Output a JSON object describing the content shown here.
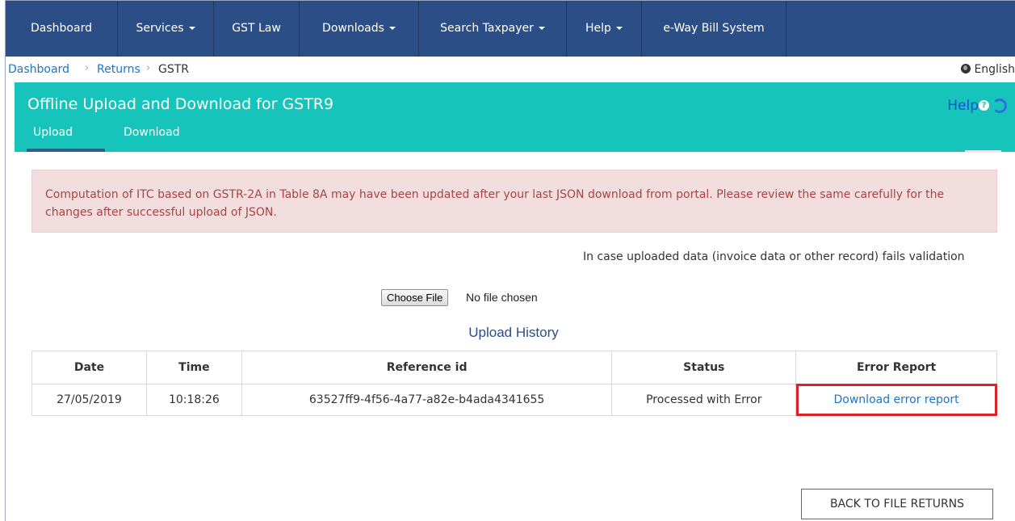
{
  "nav": {
    "items": [
      {
        "label": "Dashboard",
        "dropdown": false
      },
      {
        "label": "Services",
        "dropdown": true
      },
      {
        "label": "GST Law",
        "dropdown": false
      },
      {
        "label": "Downloads",
        "dropdown": true
      },
      {
        "label": "Search Taxpayer",
        "dropdown": true
      },
      {
        "label": "Help",
        "dropdown": true
      },
      {
        "label": "e-Way Bill System",
        "dropdown": false
      }
    ]
  },
  "breadcrumb": {
    "items": [
      "Dashboard",
      "Returns",
      "GSTR"
    ],
    "separator": "›"
  },
  "language": "English",
  "panel": {
    "title": "Offline Upload and Download for GSTR9",
    "help_label": "Help",
    "tabs": [
      {
        "label": "Upload",
        "active": true
      },
      {
        "label": "Download",
        "active": false
      }
    ]
  },
  "alert": {
    "text": "Computation of ITC based on GSTR-2A in Table 8A may have been updated after your last JSON download from portal. Please review the same carefully for the changes after successful upload of JSON."
  },
  "note": "In case uploaded data (invoice data or other record) fails validation",
  "file_input": {
    "button_label": "Choose File",
    "status": "No file chosen"
  },
  "history": {
    "title": "Upload History",
    "columns": [
      "Date",
      "Time",
      "Reference id",
      "Status",
      "Error Report"
    ],
    "rows": [
      {
        "date": "27/05/2019",
        "time": "10:18:26",
        "reference_id": "63527ff9-4f56-4a77-a82e-b4ada4341655",
        "status": "Processed with Error",
        "error_report": "Download error report"
      }
    ]
  },
  "back_button": "BACK TO FILE RETURNS",
  "colors": {
    "nav_bg": "#2c4e86",
    "panel_bg": "#17c4bb",
    "alert_bg": "#f2dede",
    "alert_text": "#a94442",
    "link": "#1e75c4",
    "highlight": "#d8232a"
  },
  "icons": [
    "caret-down-icon",
    "globe-icon",
    "help-circle-icon",
    "refresh-icon"
  ]
}
